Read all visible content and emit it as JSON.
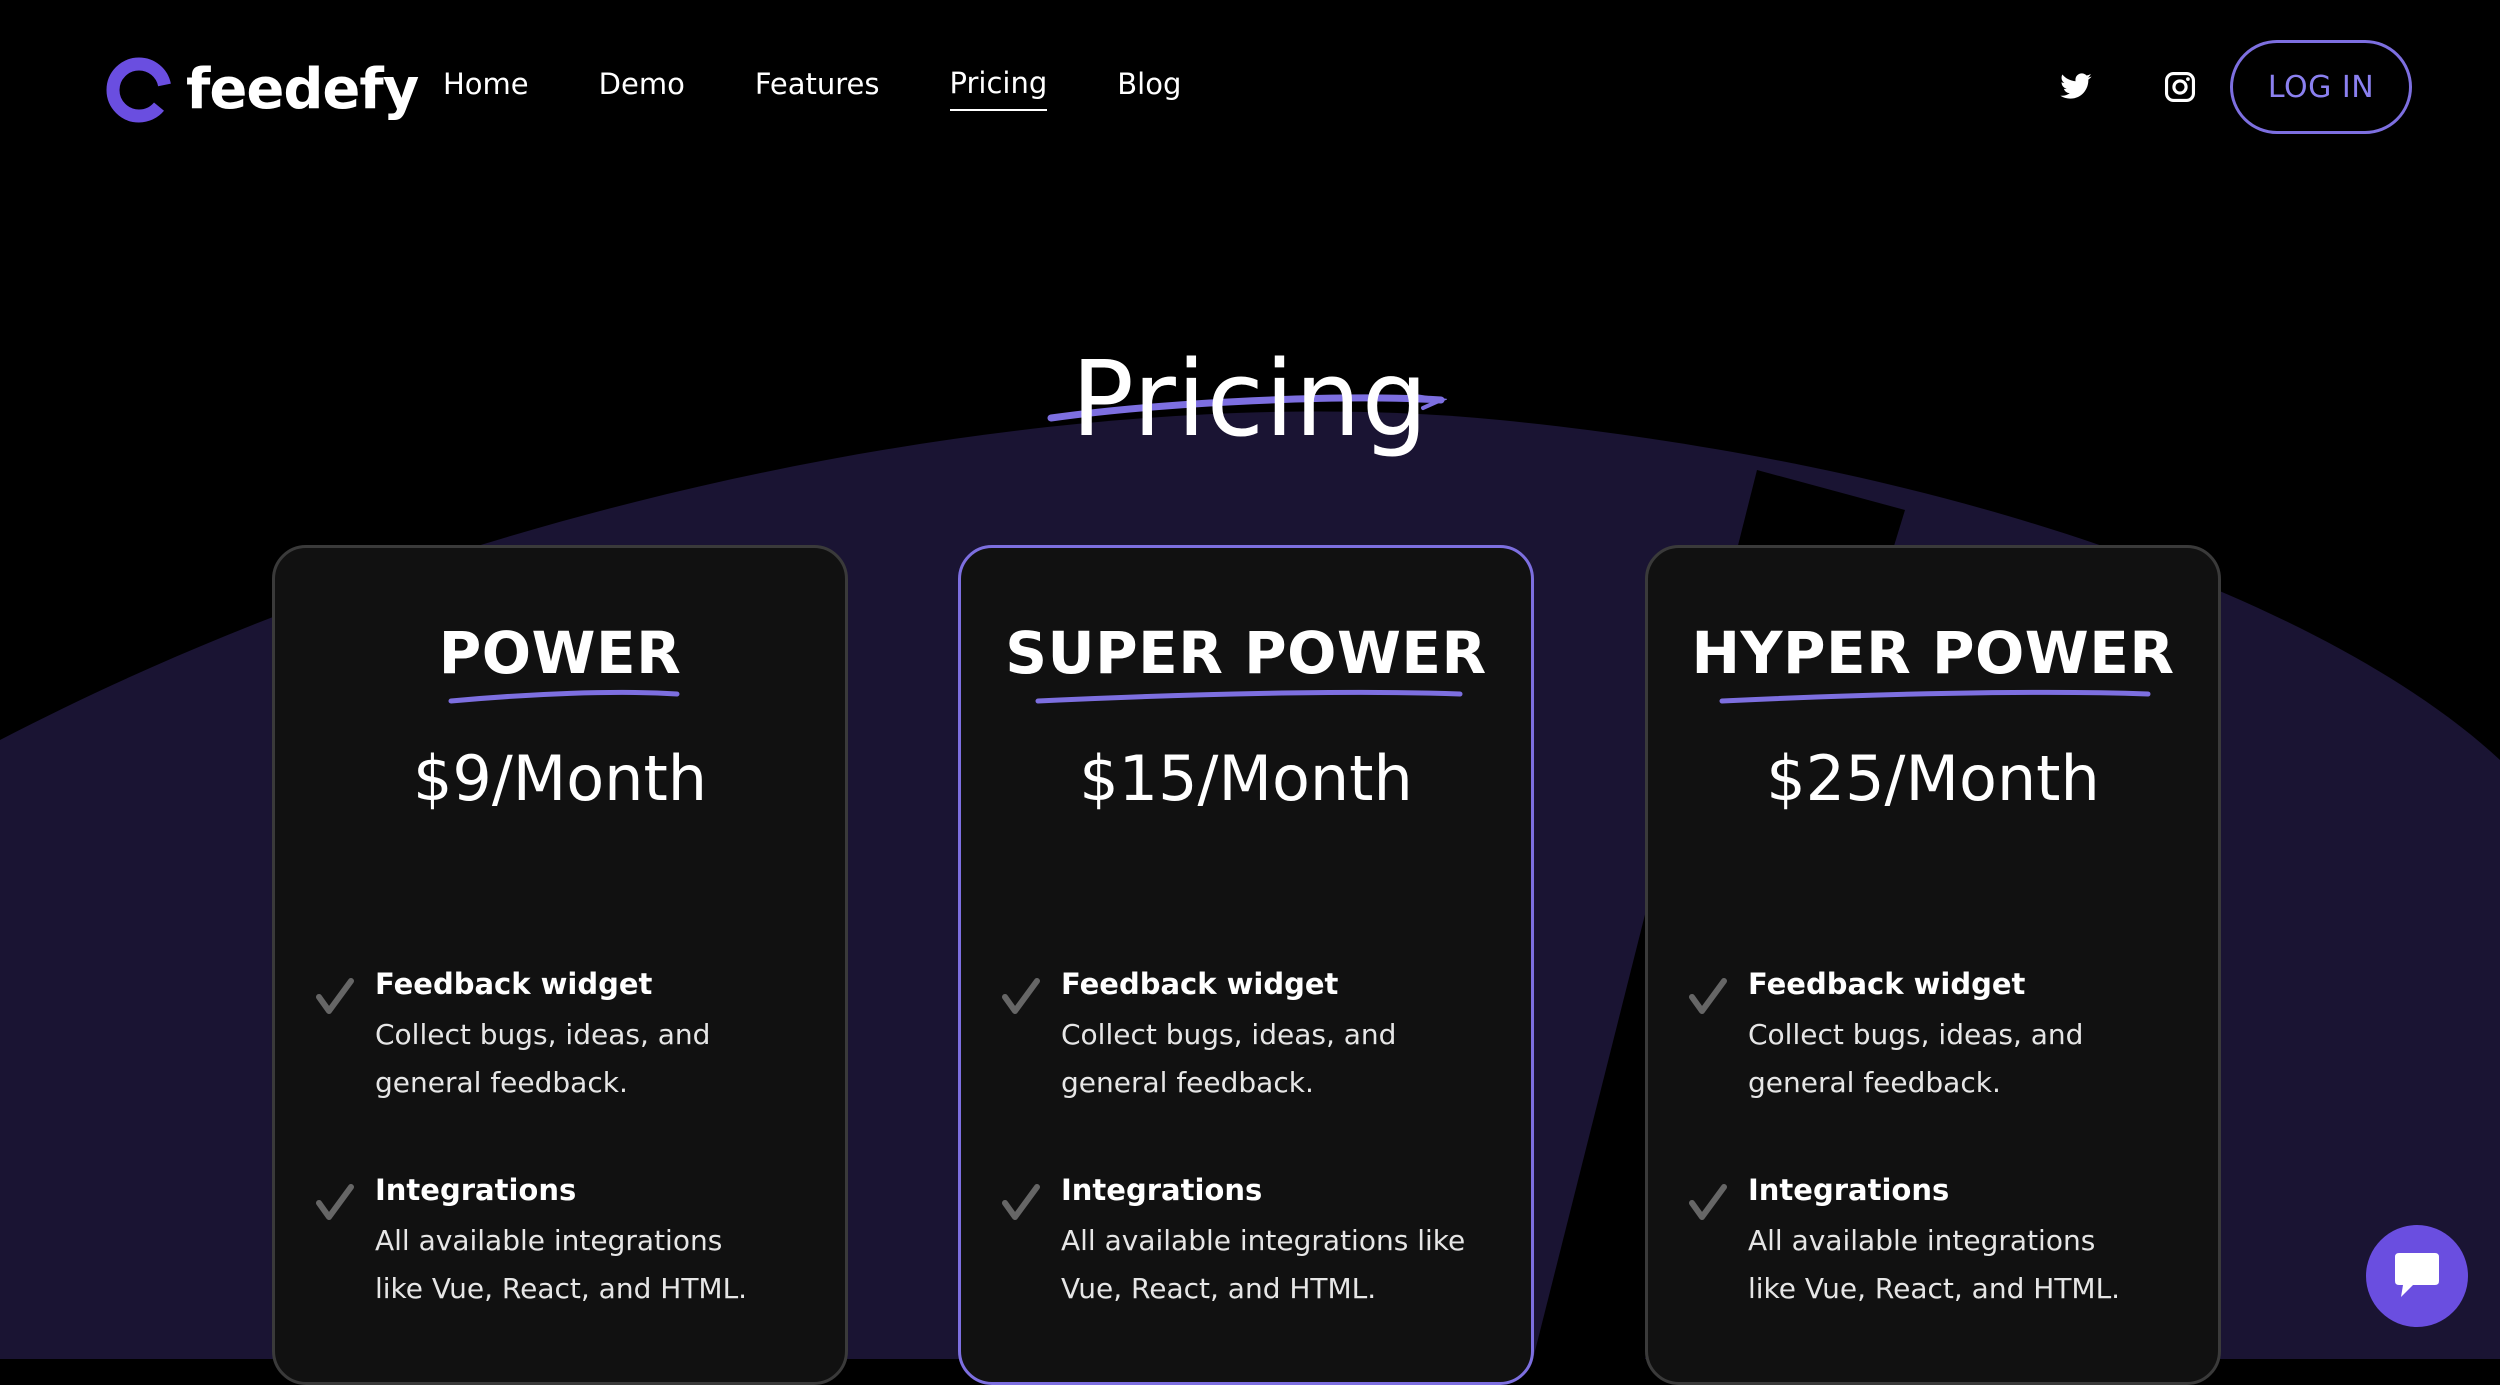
{
  "brand": {
    "name": "feedefy",
    "accent": "#7d6fe0",
    "logo_color": "#6a4ee0",
    "background": "#000000",
    "shape_color": "#1a1433"
  },
  "nav": {
    "items": [
      {
        "label": "Home",
        "active": false
      },
      {
        "label": "Demo",
        "active": false
      },
      {
        "label": "Features",
        "active": false
      },
      {
        "label": "Pricing",
        "active": true
      },
      {
        "label": "Blog",
        "active": false
      }
    ]
  },
  "header": {
    "social": [
      "twitter-icon",
      "instagram-icon"
    ],
    "login_label": "LOG IN"
  },
  "page": {
    "title": "Pricing"
  },
  "plans": [
    {
      "name": "POWER",
      "price": "$9/Month",
      "featured": false,
      "features": [
        {
          "title": "Feedback widget",
          "description": "Collect bugs, ideas, and general feedback."
        },
        {
          "title": "Integrations",
          "description": "All available integrations like Vue, React, and HTML."
        }
      ]
    },
    {
      "name": "SUPER POWER",
      "price": "$15/Month",
      "featured": true,
      "features": [
        {
          "title": "Feedback widget",
          "description": "Collect bugs, ideas, and general feedback."
        },
        {
          "title": "Integrations",
          "description": "All available integrations like Vue, React, and HTML."
        }
      ]
    },
    {
      "name": "HYPER POWER",
      "price": "$25/Month",
      "featured": false,
      "features": [
        {
          "title": "Feedback widget",
          "description": "Collect bugs, ideas, and general feedback."
        },
        {
          "title": "Integrations",
          "description": "All available integrations like Vue, React, and HTML."
        }
      ]
    }
  ],
  "chat": {
    "icon": "chat-bubble-icon"
  }
}
